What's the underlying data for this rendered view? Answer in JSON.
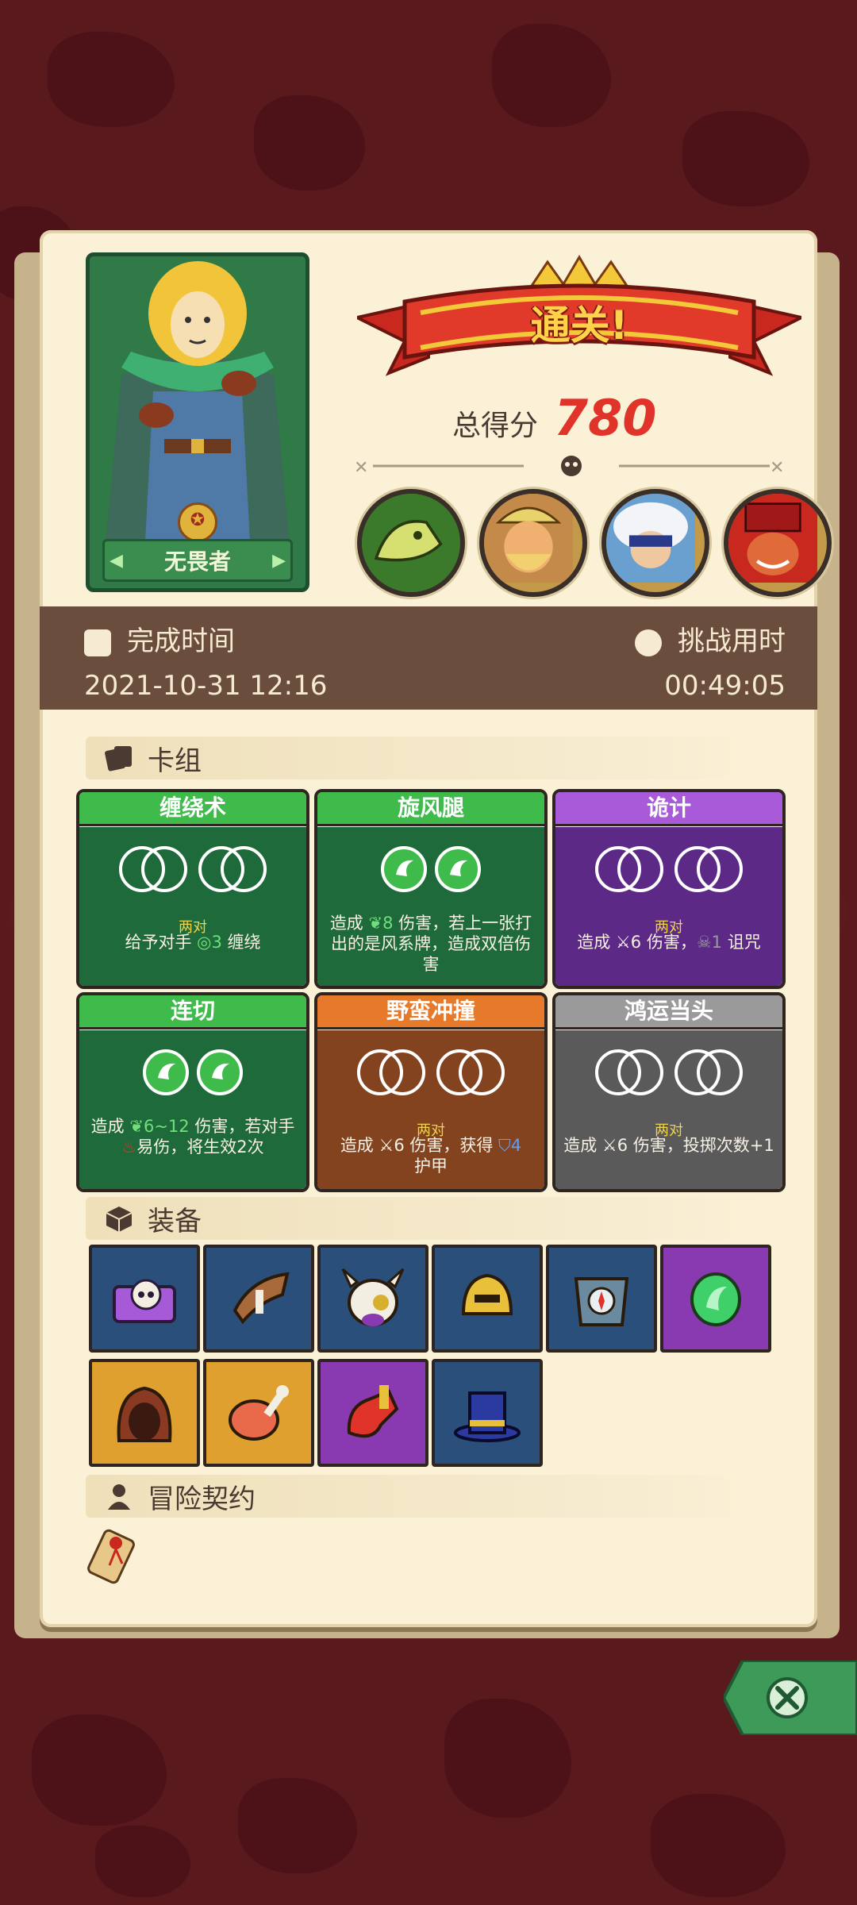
{
  "hero": {
    "name": "无畏者",
    "prev_icon": "arrow-left-icon",
    "next_icon": "arrow-right-icon"
  },
  "result": {
    "title": "通关!",
    "score_label": "总得分",
    "score_value": "780"
  },
  "bosses": [
    "dinosaur-skeleton-boss",
    "viking-boss",
    "sheep-boss",
    "clown-boss"
  ],
  "time": {
    "finish_label": "完成时间",
    "finish_value": "2021-10-31 12:16",
    "challenge_label": "挑战用时",
    "challenge_value": "00:49:05"
  },
  "deck": {
    "title": "卡组",
    "pair_label": "两对",
    "cards": [
      {
        "name": "缠绕术",
        "color": "green",
        "dice": "rings",
        "pair": "两对",
        "desc": [
          "给予对手 ",
          "3",
          " 缠绕"
        ]
      },
      {
        "name": "旋风腿",
        "color": "green",
        "dice": "gems",
        "desc": [
          "造成 ",
          "8",
          " 伤害，若上一张打出的是风系牌，造成双倍伤害"
        ]
      },
      {
        "name": "诡计",
        "color": "purple",
        "dice": "rings",
        "pair": "两对",
        "desc": [
          "造成 ",
          "6 伤害，",
          "1",
          " 诅咒"
        ]
      },
      {
        "name": "连切",
        "color": "green",
        "dice": "gems",
        "desc": [
          "造成 ",
          "6~12",
          " 伤害，若对手",
          "易伤，将生效2次"
        ]
      },
      {
        "name": "野蛮冲撞",
        "color": "orange",
        "dice": "rings",
        "pair": "两对",
        "desc": [
          "造成 ",
          "6 伤害，获得 ",
          "4",
          "护甲"
        ]
      },
      {
        "name": "鸿运当头",
        "color": "grey",
        "dice": "rings",
        "pair": "两对",
        "desc": [
          "造成 ",
          "6 伤害，投掷次数+1"
        ]
      }
    ]
  },
  "equipment": {
    "title": "装备",
    "items": [
      "skull-book",
      "horn",
      "horned-skull-mask",
      "golden-helmet",
      "compass-armor",
      "green-gem",
      "brown-hood",
      "ham",
      "red-gauntlet",
      "blue-top-hat"
    ]
  },
  "contract": {
    "title": "冒险契约",
    "item": "scroll-icon"
  },
  "close": {
    "icon": "close-icon"
  }
}
